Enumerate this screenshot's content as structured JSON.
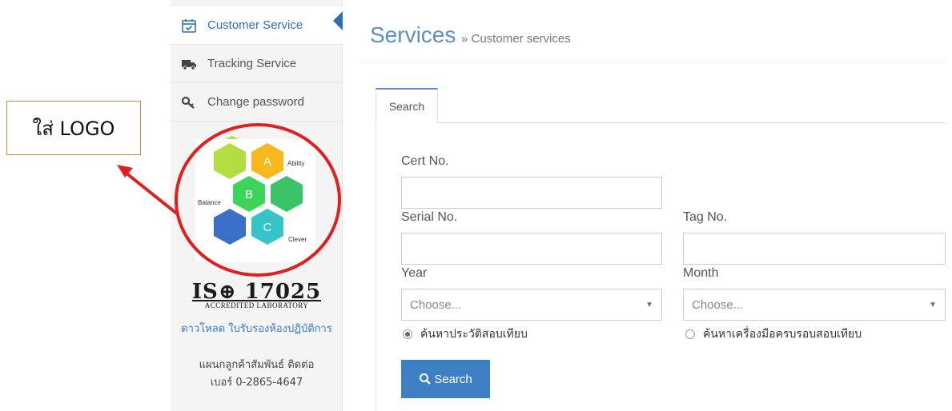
{
  "annotation": {
    "label": "ใส่ LOGO",
    "color": "#e02020"
  },
  "sidebar": {
    "items": [
      {
        "label": "Customer Service",
        "icon": "calendar-check-icon",
        "active": true
      },
      {
        "label": "Tracking Service",
        "icon": "truck-icon",
        "active": false
      },
      {
        "label": "Change password",
        "icon": "key-icon",
        "active": false
      }
    ],
    "logo": {
      "letters": [
        "A",
        "B",
        "C"
      ],
      "words": [
        "Ability",
        "Balance",
        "Clever"
      ]
    },
    "iso": {
      "main": "IS⊕ 17025",
      "sub": "ACCREDITED LABORATORY"
    },
    "download_link": "ดาวโหลด ใบรับรองห้องปฏิบัติการ",
    "contact_line1": "แผนกลูกค้าสัมพันธ์ ติดต่อ",
    "contact_line2": "เบอร์ 0-2865-4647"
  },
  "header": {
    "title": "Services",
    "breadcrumb": "» Customer services"
  },
  "tabs": [
    {
      "label": "Search",
      "active": true
    }
  ],
  "form": {
    "cert_label": "Cert No.",
    "cert_value": "",
    "serial_label": "Serial No.",
    "serial_value": "",
    "tag_label": "Tag No.",
    "tag_value": "",
    "year_label": "Year",
    "year_value": "Choose...",
    "month_label": "Month",
    "month_value": "Choose...",
    "radio1_label": "ค้นหาประวัติสอบเทียบ",
    "radio2_label": "ค้นหาเครื่องมือครบรอบสอบเทียบ",
    "search_label": "Search"
  },
  "colors": {
    "accent": "#3d7fc4",
    "title": "#5b8fc4",
    "link": "#3a7bc8"
  }
}
